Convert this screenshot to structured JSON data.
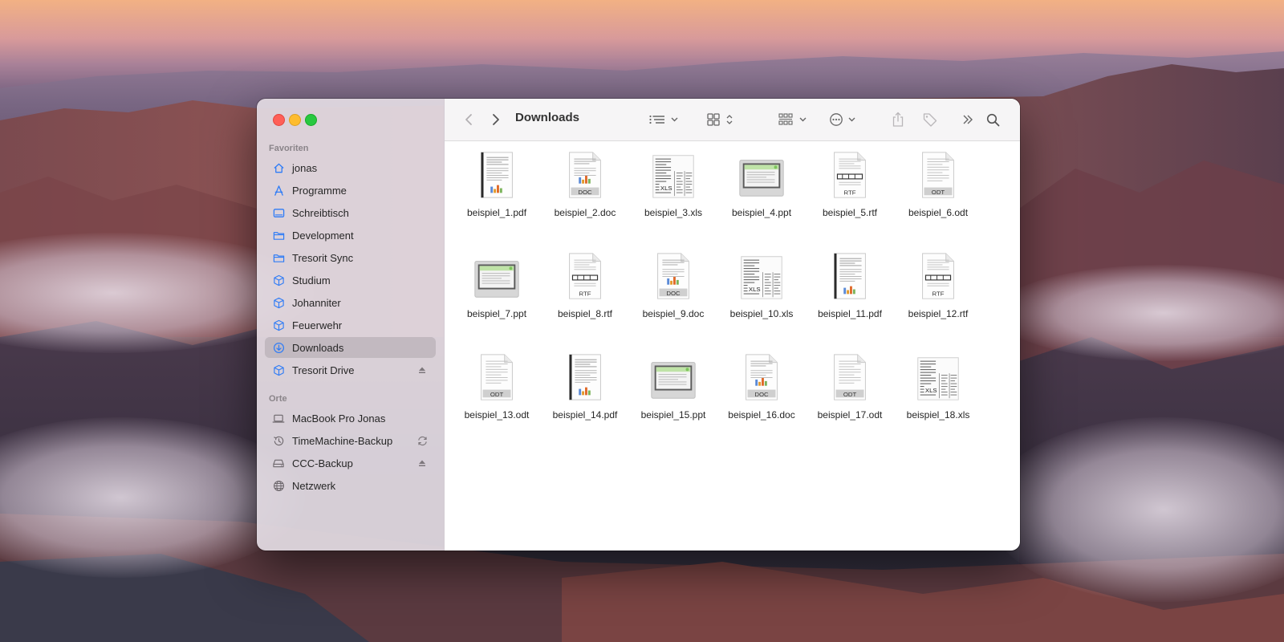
{
  "sidebar": {
    "section_favorites": "Favoriten",
    "favorites": [
      {
        "label": "jonas",
        "icon": "home-icon"
      },
      {
        "label": "Programme",
        "icon": "applications-icon"
      },
      {
        "label": "Schreibtisch",
        "icon": "desktop-icon"
      },
      {
        "label": "Development",
        "icon": "folder-icon"
      },
      {
        "label": "Tresorit Sync",
        "icon": "folder-icon"
      },
      {
        "label": "Studium",
        "icon": "tresorit-cube-icon"
      },
      {
        "label": "Johanniter",
        "icon": "tresorit-cube-icon"
      },
      {
        "label": "Feuerwehr",
        "icon": "tresorit-cube-icon"
      },
      {
        "label": "Downloads",
        "icon": "downloads-icon",
        "selected": true
      },
      {
        "label": "Tresorit Drive",
        "icon": "tresorit-cube-icon",
        "trailing": "eject-icon"
      }
    ],
    "section_locations": "Orte",
    "locations": [
      {
        "label": "MacBook Pro Jonas",
        "icon": "laptop-icon"
      },
      {
        "label": "TimeMachine-Backup",
        "icon": "time-machine-icon",
        "trailing": "sync-icon"
      },
      {
        "label": "CCC-Backup",
        "icon": "external-drive-icon",
        "trailing": "eject-icon"
      },
      {
        "label": "Netzwerk",
        "icon": "network-globe-icon"
      }
    ]
  },
  "toolbar": {
    "title": "Downloads",
    "buttons": [
      "back-icon",
      "forward-icon",
      "list-view-icon",
      "icon-grid-view-icon",
      "group-by-icon",
      "more-actions-icon",
      "share-icon",
      "tag-icon",
      "toolbar-overflow-icon",
      "search-icon"
    ]
  },
  "files": [
    {
      "name": "beispiel_1.pdf",
      "type": "pdf"
    },
    {
      "name": "beispiel_2.doc",
      "type": "doc",
      "badge": "DOC"
    },
    {
      "name": "beispiel_3.xls",
      "type": "xls",
      "badge": "XLS"
    },
    {
      "name": "beispiel_4.ppt",
      "type": "ppt"
    },
    {
      "name": "beispiel_5.rtf",
      "type": "rtf",
      "badge": "RTF"
    },
    {
      "name": "beispiel_6.odt",
      "type": "odt",
      "badge": "ODT"
    },
    {
      "name": "beispiel_7.ppt",
      "type": "ppt"
    },
    {
      "name": "beispiel_8.rtf",
      "type": "rtf",
      "badge": "RTF"
    },
    {
      "name": "beispiel_9.doc",
      "type": "doc",
      "badge": "DOC"
    },
    {
      "name": "beispiel_10.xls",
      "type": "xls",
      "badge": "XLS"
    },
    {
      "name": "beispiel_11.pdf",
      "type": "pdf"
    },
    {
      "name": "beispiel_12.rtf",
      "type": "rtf",
      "badge": "RTF"
    },
    {
      "name": "beispiel_13.odt",
      "type": "odt",
      "badge": "ODT"
    },
    {
      "name": "beispiel_14.pdf",
      "type": "pdf"
    },
    {
      "name": "beispiel_15.ppt",
      "type": "ppt"
    },
    {
      "name": "beispiel_16.doc",
      "type": "doc",
      "badge": "DOC"
    },
    {
      "name": "beispiel_17.odt",
      "type": "odt",
      "badge": "ODT"
    },
    {
      "name": "beispiel_18.xls",
      "type": "xls",
      "badge": "XLS"
    }
  ],
  "colors": {
    "accent": "#2f7cf6",
    "selection": "#dad3da"
  }
}
